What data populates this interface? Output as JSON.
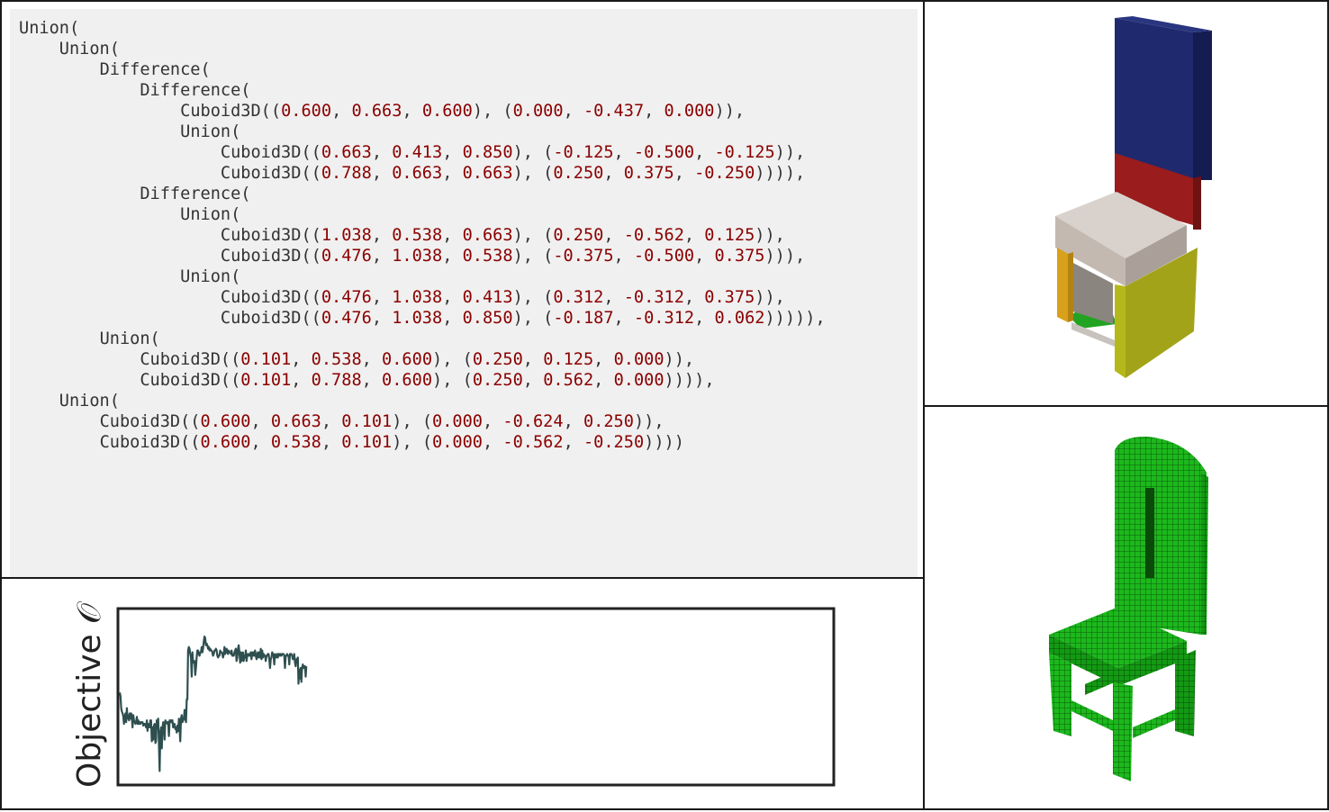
{
  "code_panel": {
    "lines": [
      {
        "indent": 0,
        "parts": [
          "Union("
        ]
      },
      {
        "indent": 1,
        "parts": [
          "Union("
        ]
      },
      {
        "indent": 2,
        "parts": [
          "Difference("
        ]
      },
      {
        "indent": 3,
        "parts": [
          "Difference("
        ]
      },
      {
        "indent": 4,
        "parts": [
          "Cuboid3D((",
          {
            "n": "0.600"
          },
          ", ",
          {
            "n": "0.663"
          },
          ", ",
          {
            "n": "0.600"
          },
          "), (",
          {
            "n": "0.000"
          },
          ", ",
          {
            "n": "-0.437"
          },
          ", ",
          {
            "n": "0.000"
          },
          ")),"
        ]
      },
      {
        "indent": 4,
        "parts": [
          "Union("
        ]
      },
      {
        "indent": 5,
        "parts": [
          "Cuboid3D((",
          {
            "n": "0.663"
          },
          ", ",
          {
            "n": "0.413"
          },
          ", ",
          {
            "n": "0.850"
          },
          "), (",
          {
            "n": "-0.125"
          },
          ", ",
          {
            "n": "-0.500"
          },
          ", ",
          {
            "n": "-0.125"
          },
          ")),"
        ]
      },
      {
        "indent": 5,
        "parts": [
          "Cuboid3D((",
          {
            "n": "0.788"
          },
          ", ",
          {
            "n": "0.663"
          },
          ", ",
          {
            "n": "0.663"
          },
          "), (",
          {
            "n": "0.250"
          },
          ", ",
          {
            "n": "0.375"
          },
          ", ",
          {
            "n": "-0.250"
          },
          ")))),"
        ]
      },
      {
        "indent": 3,
        "parts": [
          "Difference("
        ]
      },
      {
        "indent": 4,
        "parts": [
          "Union("
        ]
      },
      {
        "indent": 5,
        "parts": [
          "Cuboid3D((",
          {
            "n": "1.038"
          },
          ", ",
          {
            "n": "0.538"
          },
          ", ",
          {
            "n": "0.663"
          },
          "), (",
          {
            "n": "0.250"
          },
          ", ",
          {
            "n": "-0.562"
          },
          ", ",
          {
            "n": "0.125"
          },
          ")),"
        ]
      },
      {
        "indent": 5,
        "parts": [
          "Cuboid3D((",
          {
            "n": "0.476"
          },
          ", ",
          {
            "n": "1.038"
          },
          ", ",
          {
            "n": "0.538"
          },
          "), (",
          {
            "n": "-0.375"
          },
          ", ",
          {
            "n": "-0.500"
          },
          ", ",
          {
            "n": "0.375"
          },
          "))),"
        ]
      },
      {
        "indent": 4,
        "parts": [
          "Union("
        ]
      },
      {
        "indent": 5,
        "parts": [
          "Cuboid3D((",
          {
            "n": "0.476"
          },
          ", ",
          {
            "n": "1.038"
          },
          ", ",
          {
            "n": "0.413"
          },
          "), (",
          {
            "n": "0.312"
          },
          ", ",
          {
            "n": "-0.312"
          },
          ", ",
          {
            "n": "0.375"
          },
          ")),"
        ]
      },
      {
        "indent": 5,
        "parts": [
          "Cuboid3D((",
          {
            "n": "0.476"
          },
          ", ",
          {
            "n": "1.038"
          },
          ", ",
          {
            "n": "0.850"
          },
          "), (",
          {
            "n": "-0.187"
          },
          ", ",
          {
            "n": "-0.312"
          },
          ", ",
          {
            "n": "0.062"
          },
          "))))),"
        ]
      },
      {
        "indent": 2,
        "parts": [
          "Union("
        ]
      },
      {
        "indent": 3,
        "parts": [
          "Cuboid3D((",
          {
            "n": "0.101"
          },
          ", ",
          {
            "n": "0.538"
          },
          ", ",
          {
            "n": "0.600"
          },
          "), (",
          {
            "n": "0.250"
          },
          ", ",
          {
            "n": "0.125"
          },
          ", ",
          {
            "n": "0.000"
          },
          ")),"
        ]
      },
      {
        "indent": 3,
        "parts": [
          "Cuboid3D((",
          {
            "n": "0.101"
          },
          ", ",
          {
            "n": "0.788"
          },
          ", ",
          {
            "n": "0.600"
          },
          "), (",
          {
            "n": "0.250"
          },
          ", ",
          {
            "n": "0.562"
          },
          ", ",
          {
            "n": "0.000"
          },
          ")))),"
        ]
      },
      {
        "indent": 1,
        "parts": [
          "Union("
        ]
      },
      {
        "indent": 2,
        "parts": [
          "Cuboid3D((",
          {
            "n": "0.600"
          },
          ", ",
          {
            "n": "0.663"
          },
          ", ",
          {
            "n": "0.101"
          },
          "), (",
          {
            "n": "0.000"
          },
          ", ",
          {
            "n": "-0.624"
          },
          ", ",
          {
            "n": "0.250"
          },
          ")),"
        ]
      },
      {
        "indent": 2,
        "parts": [
          "Cuboid3D((",
          {
            "n": "0.600"
          },
          ", ",
          {
            "n": "0.538"
          },
          ", ",
          {
            "n": "0.101"
          },
          "), (",
          {
            "n": "0.000"
          },
          ", ",
          {
            "n": "-0.562"
          },
          ", ",
          {
            "n": "-0.250"
          },
          "))))"
        ]
      }
    ],
    "colors": {
      "text": "#333333",
      "number": "#8b0000",
      "background": "#f0f0f0"
    }
  },
  "plot_panel": {
    "ylabel": "Objective",
    "ylabel_symbol": "𝒪",
    "line_color": "#2f4f4f"
  },
  "chart_data": {
    "type": "line",
    "title": "",
    "xlabel": "",
    "ylabel": "Objective 𝒪",
    "xlim": [
      0,
      1000
    ],
    "ylim": [
      0,
      1
    ],
    "grid": false,
    "series": [
      {
        "values": [
          0.53,
          0.51,
          0.44,
          0.42,
          0.41,
          0.39,
          0.35,
          0.39,
          0.41,
          0.36,
          0.44,
          0.38,
          0.4,
          0.37,
          0.41,
          0.38,
          0.41,
          0.39,
          0.33,
          0.4,
          0.37,
          0.36,
          0.35,
          0.36,
          0.39,
          0.35,
          0.37,
          0.35,
          0.36,
          0.35,
          0.36,
          0.36,
          0.36,
          0.34,
          0.35,
          0.35,
          0.34,
          0.33,
          0.37,
          0.31,
          0.35,
          0.34,
          0.33,
          0.37,
          0.37,
          0.25,
          0.33,
          0.26,
          0.34,
          0.35,
          0.24,
          0.25,
          0.37,
          0.36,
          0.38,
          0.23,
          0.08,
          0.3,
          0.33,
          0.21,
          0.33,
          0.36,
          0.34,
          0.26,
          0.37,
          0.36,
          0.36,
          0.35,
          0.36,
          0.28,
          0.37,
          0.36,
          0.37,
          0.36,
          0.37,
          0.33,
          0.34,
          0.35,
          0.32,
          0.33,
          0.3,
          0.34,
          0.31,
          0.38,
          0.33,
          0.25,
          0.38,
          0.4,
          0.36,
          0.37,
          0.38,
          0.43,
          0.38,
          0.36,
          0.49,
          0.49,
          0.77,
          0.79,
          0.78,
          0.75,
          0.73,
          0.62,
          0.76,
          0.7,
          0.71,
          0.71,
          0.63,
          0.67,
          0.73,
          0.77,
          0.77,
          0.75,
          0.74,
          0.76,
          0.76,
          0.79,
          0.76,
          0.78,
          0.82,
          0.85,
          0.84,
          0.8,
          0.81,
          0.8,
          0.78,
          0.79,
          0.77,
          0.78,
          0.77,
          0.77,
          0.76,
          0.74,
          0.75,
          0.77,
          0.77,
          0.78,
          0.77,
          0.74,
          0.73,
          0.74,
          0.74,
          0.77,
          0.76,
          0.76,
          0.75,
          0.73,
          0.75,
          0.79,
          0.75,
          0.77,
          0.78,
          0.76,
          0.75,
          0.77,
          0.76,
          0.76,
          0.75,
          0.77,
          0.74,
          0.74,
          0.74,
          0.76,
          0.77,
          0.78,
          0.71,
          0.73,
          0.78,
          0.8,
          0.76,
          0.7,
          0.76,
          0.71,
          0.75,
          0.76,
          0.71,
          0.74,
          0.73,
          0.77,
          0.71,
          0.74,
          0.75,
          0.74,
          0.75,
          0.74,
          0.76,
          0.72,
          0.76,
          0.74,
          0.76,
          0.74,
          0.77,
          0.74,
          0.72,
          0.75,
          0.76,
          0.73,
          0.76,
          0.73,
          0.78,
          0.72,
          0.77,
          0.73,
          0.75,
          0.74,
          0.74,
          0.71,
          0.74,
          0.74,
          0.75,
          0.75,
          0.72,
          0.67,
          0.72,
          0.73,
          0.76,
          0.75,
          0.74,
          0.69,
          0.75,
          0.74,
          0.73,
          0.75,
          0.73,
          0.75,
          0.75,
          0.74,
          0.75,
          0.74,
          0.75,
          0.75,
          0.75,
          0.74,
          0.67,
          0.74,
          0.74,
          0.75,
          0.74,
          0.74,
          0.69,
          0.75,
          0.75,
          0.75,
          0.74,
          0.72,
          0.73,
          0.75,
          0.7,
          0.68,
          0.72,
          0.72,
          0.73,
          0.58,
          0.66,
          0.61,
          0.67,
          0.59,
          0.67,
          0.69,
          0.67,
          0.68,
          0.68,
          0.62,
          0.68
        ]
      }
    ]
  },
  "renders": {
    "top_label": "",
    "bottom_label": ""
  }
}
